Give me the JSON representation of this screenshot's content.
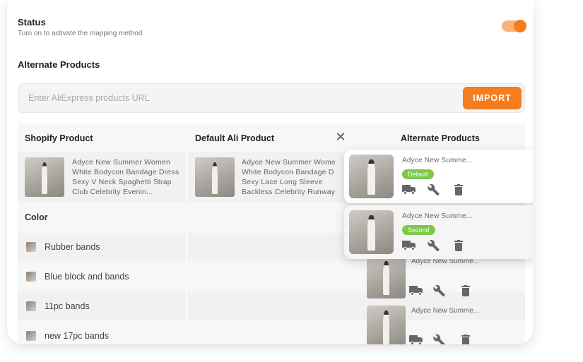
{
  "status": {
    "title": "Status",
    "subtitle": "Turn on to activate the mapping method",
    "toggle_on": true,
    "accent_color": "#f57c1f"
  },
  "alternate": {
    "title": "Alternate Products",
    "url_placeholder": "Enter AliExpress products URL",
    "url_value": "",
    "import_label": "IMPORT"
  },
  "table": {
    "headers": {
      "shopify": "Shopify Product",
      "default_ali": "Default Ali Product",
      "alternate": "Alternate Products"
    },
    "shopify_product": {
      "line1": "Adyce New Summer Women",
      "line2": "White Bodycon Bandage Dress",
      "line3": "Sexy V Neck Spaghetti Strap",
      "line4": "Club Celebrity Evenin..."
    },
    "default_ali_product": {
      "line1": "Adyce New Summer Wome",
      "line2": "White Bodycon Bandage D",
      "line3": "Sexy Lace Long Sleeve",
      "line4": "Backless Celebrity Runway"
    },
    "color_label": "Color",
    "variants": [
      "Rubber bands",
      "Blue block and bands",
      "11pc bands",
      "new 17pc bands"
    ],
    "alternate_items": [
      {
        "name": "Adyce New Summe..."
      },
      {
        "name": "Adyce New Summe..."
      }
    ]
  },
  "popups": [
    {
      "name": "Adyce New Summe...",
      "badge": "Default",
      "badge_color": "#7cc94a"
    },
    {
      "name": "Adyce New Summe...",
      "badge": "Second",
      "badge_color": "#7cc94a"
    }
  ],
  "icons": {
    "close": "close-icon",
    "shipping": "truck-icon",
    "settings": "wrench-icon",
    "delete": "trash-icon"
  }
}
